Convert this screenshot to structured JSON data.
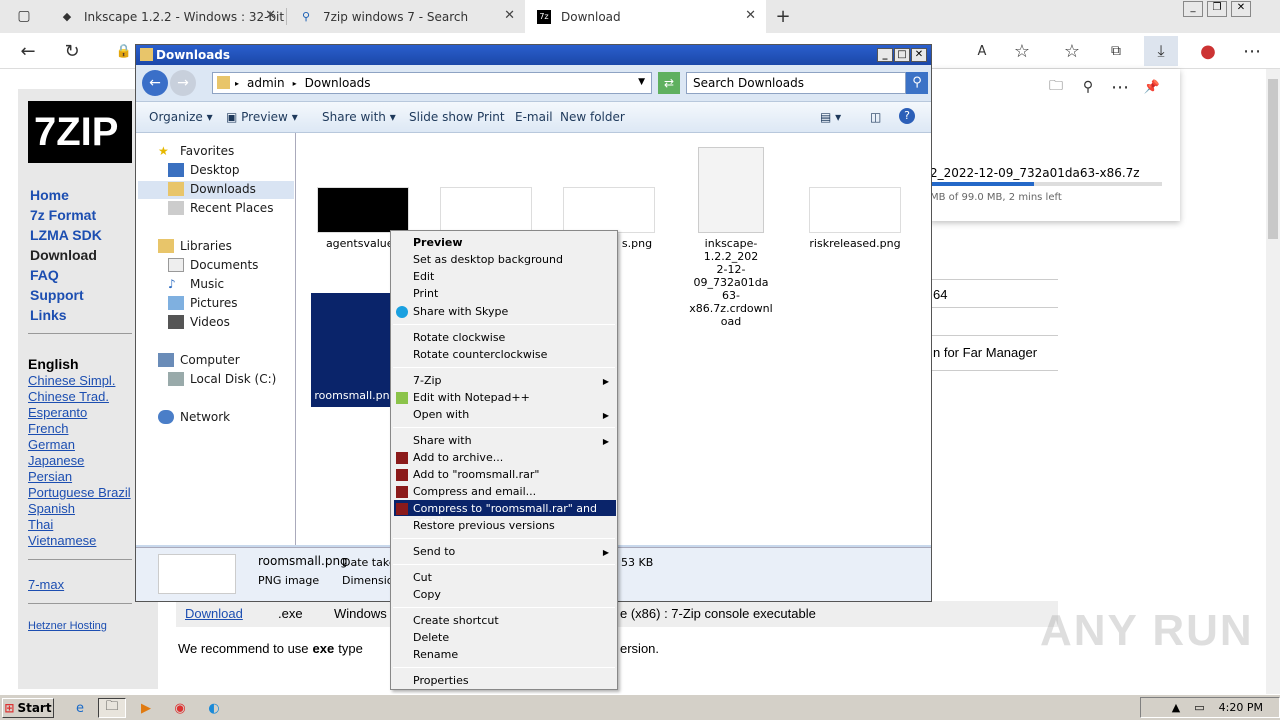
{
  "browser": {
    "tabs": [
      {
        "label": "Inkscape 1.2.2 - Windows : 32-bit",
        "icon": "inkscape-icon"
      },
      {
        "label": "7zip windows 7 - Search",
        "icon": "search-icon"
      },
      {
        "label": "Download",
        "icon": "7z-icon"
      }
    ],
    "new_tab": "+"
  },
  "site": {
    "logo": "7ZIP",
    "menu": [
      "Home",
      "7z Format",
      "LZMA SDK",
      "Download",
      "FAQ",
      "Support",
      "Links"
    ],
    "lang_heading": "English",
    "languages": [
      "Chinese Simpl.",
      "Chinese Trad.",
      "Esperanto",
      "French",
      "German",
      "Japanese",
      "Persian",
      "Portuguese Brazil",
      "Spanish",
      "Thai",
      "Vietnamese"
    ],
    "extra_link": "7-max",
    "hosting": "Hetzner Hosting",
    "row_text_1": "64",
    "row_text_2": "n for Far Manager",
    "table_row": {
      "link": "Download",
      "ext": ".exe",
      "os": "Windows",
      "desc": "e (x86) : 7-Zip console executable"
    },
    "recommend": "We recommend to use",
    "recommend_bold": "exe",
    "recommend_rest": "type",
    "recommend_tail": "ersion."
  },
  "downloads_flyout": {
    "filename": "2_2022-12-09_732a01da63-x86.7z",
    "progress_text": "MB of 99.0 MB, 2 mins left",
    "progress": 0.45
  },
  "explorer": {
    "title": "Downloads",
    "path": [
      "admin",
      "Downloads"
    ],
    "search_placeholder": "Search Downloads",
    "toolbar": [
      "Organize",
      "Preview",
      "Share with",
      "Slide show",
      "Print",
      "E-mail",
      "New folder"
    ],
    "tree": {
      "favorites": "Favorites",
      "desktop": "Desktop",
      "downloads": "Downloads",
      "recent": "Recent Places",
      "libraries": "Libraries",
      "documents": "Documents",
      "music": "Music",
      "pictures": "Pictures",
      "videos": "Videos",
      "computer": "Computer",
      "localdisk": "Local Disk (C:)",
      "network": "Network"
    },
    "files": {
      "f1": "agentsvalue.j",
      "f3": "s.png",
      "f4_line1": "inkscape-1.2.2_202",
      "f4_line2": "2-12-09_732a01da",
      "f4_line3": "63-x86.7z.crdownl",
      "f4_line4": "oad",
      "f5": "riskreleased.png",
      "f6": "roomsmall.pn"
    },
    "details": {
      "name": "roomsmall.png",
      "date_label": "Date taken",
      "type": "PNG image",
      "dim_label": "Dimension",
      "size": "53 KB"
    }
  },
  "context_menu": {
    "items": [
      "Preview",
      "Set as desktop background",
      "Edit",
      "Print",
      "Share with Skype",
      "Rotate clockwise",
      "Rotate counterclockwise",
      "7-Zip",
      "Edit with Notepad++",
      "Open with",
      "Share with",
      "Add to archive...",
      "Add to \"roomsmall.rar\"",
      "Compress and email...",
      "Compress to \"roomsmall.rar\" and email",
      "Restore previous versions",
      "Send to",
      "Cut",
      "Copy",
      "Create shortcut",
      "Delete",
      "Rename",
      "Properties"
    ]
  },
  "taskbar": {
    "start": "Start",
    "time": "4:20 PM"
  },
  "watermark": "ANY RUN"
}
